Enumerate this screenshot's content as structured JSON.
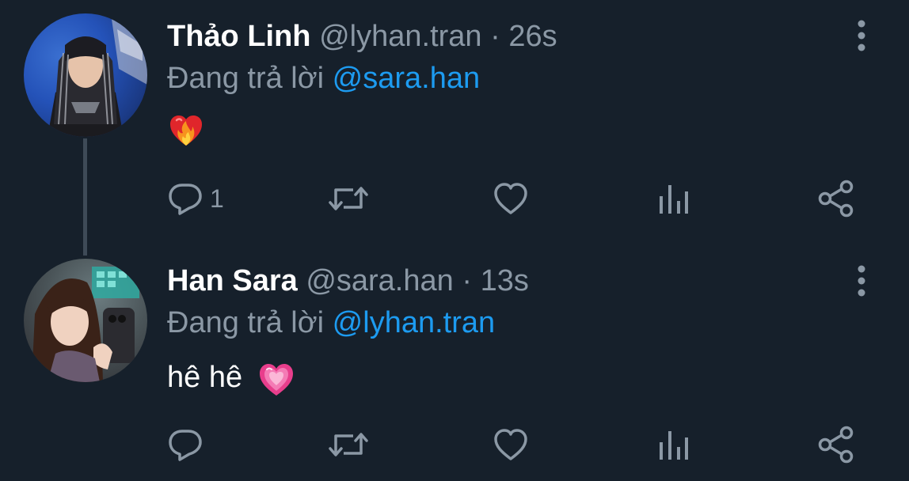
{
  "colors": {
    "background": "#16202b",
    "text_primary": "#ffffff",
    "text_secondary": "#8b98a5",
    "mention": "#1d9bf0",
    "thread_line": "#3e4a57"
  },
  "tweets": [
    {
      "display_name": "Thảo Linh",
      "handle": "@lyhan.tran",
      "separator": "·",
      "time": "26s",
      "replying_prefix": "Đang trả lời",
      "replying_to": "@sara.han",
      "text": "",
      "emoji": "heart-on-fire-emoji",
      "reply_count": "1",
      "icons": [
        "reply-icon",
        "retweet-icon",
        "like-icon",
        "views-icon",
        "share-icon",
        "more-icon"
      ]
    },
    {
      "display_name": "Han Sara",
      "handle": "@sara.han",
      "separator": "·",
      "time": "13s",
      "replying_prefix": "Đang trả lời",
      "replying_to": "@lyhan.tran",
      "text": "hê hê",
      "emoji": "sparkling-heart-emoji",
      "reply_count": "",
      "icons": [
        "reply-icon",
        "retweet-icon",
        "like-icon",
        "views-icon",
        "share-icon",
        "more-icon"
      ]
    }
  ]
}
